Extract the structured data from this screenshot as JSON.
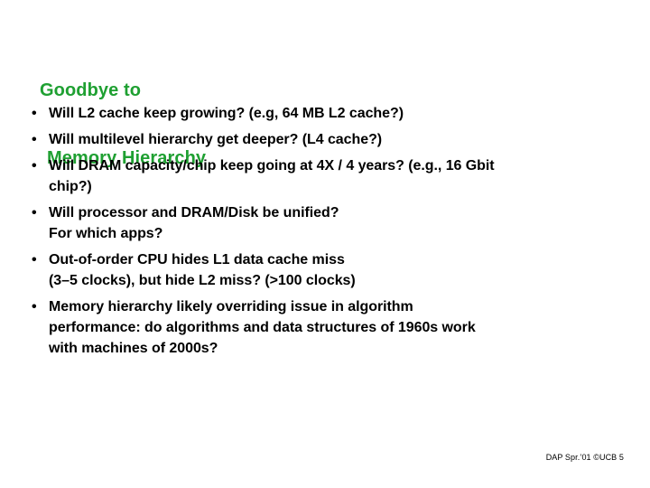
{
  "slide": {
    "background_color": "#ffffff",
    "title": {
      "color": "#1FA032",
      "line1": "Goodbye to",
      "line2": "Memory Hierarchy"
    },
    "bullets": [
      {
        "marker": "•",
        "line1": "Will L2 cache keep growing? (e.g, 64 MB L2 cache?)",
        "line2": ""
      },
      {
        "marker": "•",
        "line1": "Will multilevel hierarchy get deeper? (L4 cache?)",
        "line2": ""
      },
      {
        "marker": "•",
        "line1": "Will DRAM capacity/chip keep going at 4X / 4 years? (e.g., 16 Gbit",
        "line2": "chip?)"
      },
      {
        "marker": "•",
        "line1": "Will processor and DRAM/Disk be unified?",
        "line2": "For which apps?"
      },
      {
        "marker": "•",
        "line1": "Out-of-order CPU hides L1 data cache miss",
        "line2": "(3–5 clocks), but hide L2 miss? (>100 clocks)"
      },
      {
        "marker": "•",
        "line1": "Memory hierarchy likely overriding issue in algorithm",
        "line2": "performance: do algorithms and data structures of 1960s work",
        "line3": "with machines of 2000s?"
      }
    ],
    "footer": {
      "text": "DAP Spr.’01 ©UCB 5"
    }
  }
}
